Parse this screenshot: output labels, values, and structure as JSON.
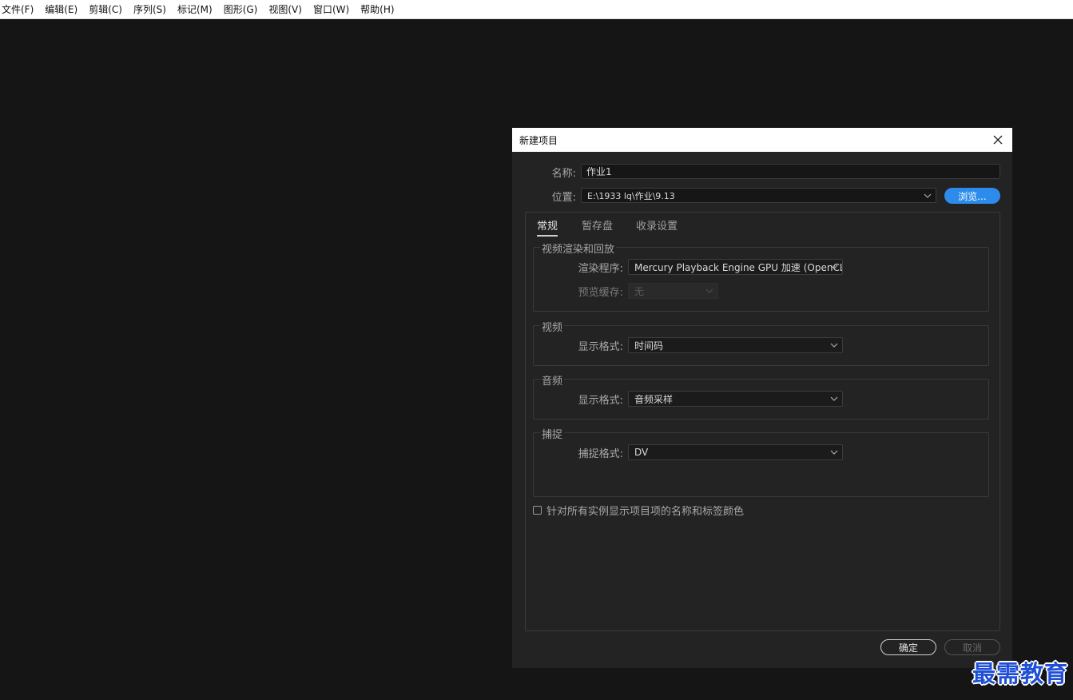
{
  "menubar": {
    "items": [
      "文件(F)",
      "编辑(E)",
      "剪辑(C)",
      "序列(S)",
      "标记(M)",
      "图形(G)",
      "视图(V)",
      "窗口(W)",
      "帮助(H)"
    ]
  },
  "dialog": {
    "title": "新建项目",
    "name_label": "名称:",
    "name_value": "作业1",
    "location_label": "位置:",
    "location_value": "E:\\1933  lq\\作业\\9.13",
    "browse_label": "浏览...",
    "tabs": [
      "常规",
      "暂存盘",
      "收录设置"
    ],
    "active_tab": "常规",
    "groups": {
      "video_render": {
        "title": "视频渲染和回放",
        "renderer_label": "渲染程序:",
        "renderer_value": "Mercury Playback Engine GPU 加速 (OpenCL)",
        "preview_cache_label": "预览缓存:",
        "preview_cache_value": "无"
      },
      "video": {
        "title": "视频",
        "display_format_label": "显示格式:",
        "display_format_value": "时间码"
      },
      "audio": {
        "title": "音频",
        "display_format_label": "显示格式:",
        "display_format_value": "音频采样"
      },
      "capture": {
        "title": "捕捉",
        "capture_format_label": "捕捉格式:",
        "capture_format_value": "DV"
      }
    },
    "checkbox_label": "针对所有实例显示项目项的名称和标签颜色",
    "checkbox_checked": false,
    "ok_label": "确定",
    "cancel_label": "取消"
  },
  "watermark": "最需教育",
  "colors": {
    "accent": "#2d8ceb",
    "background": "#151515",
    "dialog_bg": "#232323"
  }
}
